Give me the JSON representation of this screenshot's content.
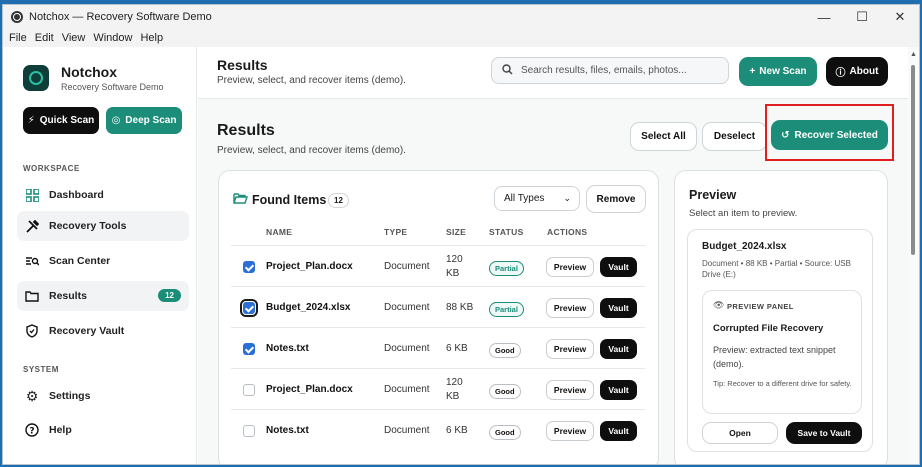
{
  "window": {
    "title": "Notchox — Recovery Software Demo",
    "controls": {
      "minimize": "—",
      "maximize": "☐",
      "close": "✕"
    }
  },
  "menu": [
    "File",
    "Edit",
    "View",
    "Window",
    "Help"
  ],
  "sidebar": {
    "brand_name": "Notchox",
    "brand_sub": "Recovery Software Demo",
    "quick_scan": "Quick Scan",
    "deep_scan": "Deep Scan",
    "workspace_label": "WORKSPACE",
    "system_label": "SYSTEM",
    "items": [
      {
        "label": "Dashboard",
        "icon": "dashboard-icon"
      },
      {
        "label": "Recovery Tools",
        "icon": "tools-icon"
      },
      {
        "label": "Scan Center",
        "icon": "scan-center-icon"
      },
      {
        "label": "Results",
        "icon": "folder-icon",
        "badge": "12"
      },
      {
        "label": "Recovery Vault",
        "icon": "shield-icon"
      },
      {
        "label": "Settings",
        "icon": "gear-icon"
      },
      {
        "label": "Help",
        "icon": "help-icon"
      }
    ]
  },
  "topbar": {
    "title": "Results",
    "subtitle": "Preview, select, and recover items (demo).",
    "search_placeholder": "Search results, files, emails, photos...",
    "new_scan": "New Scan",
    "about": "About"
  },
  "page": {
    "title": "Results",
    "subtitle": "Preview, select, and recover items (demo).",
    "select_all": "Select All",
    "deselect": "Deselect",
    "recover_selected": "Recover Selected"
  },
  "found": {
    "title": "Found Items",
    "count": "12",
    "type_filter": "All Types",
    "remove": "Remove",
    "headers": {
      "name": "NAME",
      "type": "TYPE",
      "size": "SIZE",
      "status": "STATUS",
      "actions": "ACTIONS"
    },
    "action_preview": "Preview",
    "action_vault": "Vault",
    "rows": [
      {
        "name": "Project_Plan.docx",
        "type": "Document",
        "size_a": "120",
        "size_b": "KB",
        "status": "Partial",
        "checked": true
      },
      {
        "name": "Budget_2024.xlsx",
        "type": "Document",
        "size_a": "88 KB",
        "size_b": "",
        "status": "Partial",
        "checked": true
      },
      {
        "name": "Notes.txt",
        "type": "Document",
        "size_a": "6 KB",
        "size_b": "",
        "status": "Good",
        "checked": true
      },
      {
        "name": "Project_Plan.docx",
        "type": "Document",
        "size_a": "120",
        "size_b": "KB",
        "status": "Good",
        "checked": false
      },
      {
        "name": "Notes.txt",
        "type": "Document",
        "size_a": "6 KB",
        "size_b": "",
        "status": "Good",
        "checked": false
      }
    ]
  },
  "preview": {
    "title": "Preview",
    "subtitle": "Select an item to preview.",
    "file_name": "Budget_2024.xlsx",
    "meta": "Document • 88 KB • Partial • Source: USB Drive (E:)",
    "panel_label": "PREVIEW PANEL",
    "panel_title": "Corrupted File Recovery",
    "panel_text": "Preview: extracted text snippet (demo).",
    "panel_tip": "Tip: Recover to a different drive for safety.",
    "open": "Open",
    "save": "Save to Vault"
  },
  "colors": {
    "accent": "#1b8d79",
    "dark": "#0e0e0e",
    "highlight": "#e02020"
  }
}
